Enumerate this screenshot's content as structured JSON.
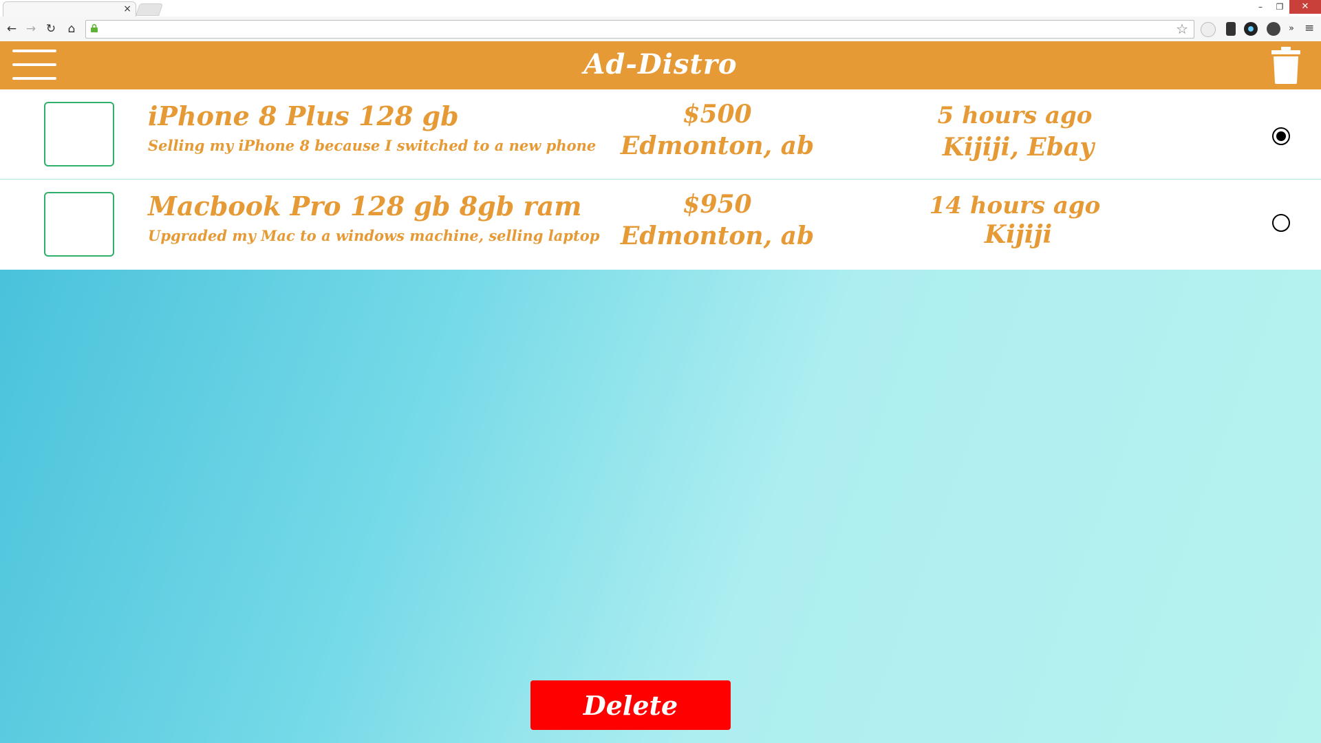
{
  "browser": {
    "tab_close_glyph": "×",
    "window_controls": [
      "–",
      "❐",
      "✕"
    ],
    "nav": {
      "back": "←",
      "forward": "→",
      "reload": "↻",
      "home": "⌂"
    },
    "bookmark_glyph": "☆",
    "overflow_glyph": "»",
    "menu_glyph": "≡"
  },
  "app": {
    "title": "Ad-Distro",
    "menu_icon": "hamburger-menu-icon",
    "trash_icon": "trash-icon",
    "accent_color": "#e69a36",
    "delete_color": "#ff0000"
  },
  "listings": [
    {
      "title": "iPhone 8 Plus 128 gb",
      "description": "Selling my iPhone 8 because I switched to a new phone",
      "price": "$500",
      "location": "Edmonton, ab",
      "posted": "5 hours ago",
      "sites": "Kijiji, Ebay",
      "selected": true
    },
    {
      "title": "Macbook Pro 128 gb 8gb ram",
      "description": "Upgraded my Mac to a windows machine, selling laptop",
      "price": "$950",
      "location": "Edmonton, ab",
      "posted": "14 hours ago",
      "sites": "Kijiji",
      "selected": false
    }
  ],
  "actions": {
    "delete_label": "Delete"
  }
}
